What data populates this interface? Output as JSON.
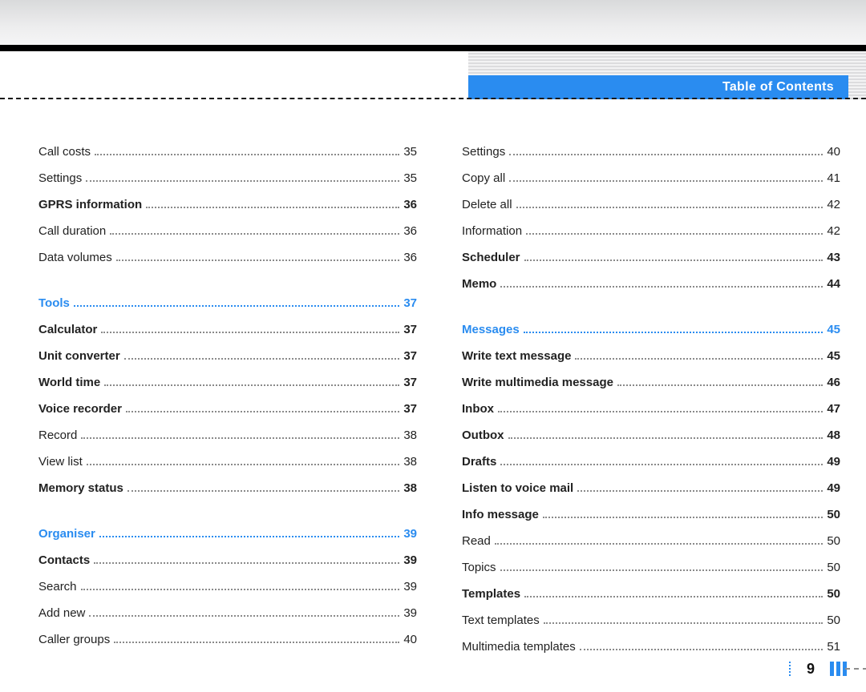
{
  "header": {
    "title": "Table of Contents"
  },
  "page_number": "9",
  "left": [
    {
      "label": "Call costs",
      "page": "35",
      "style": "plain"
    },
    {
      "label": "Settings",
      "page": "35",
      "style": "plain"
    },
    {
      "label": "GPRS information",
      "page": "36",
      "style": "bold"
    },
    {
      "label": "Call duration",
      "page": "36",
      "style": "plain"
    },
    {
      "label": "Data volumes",
      "page": "36",
      "style": "plain"
    },
    {
      "gap": true
    },
    {
      "label": "Tools",
      "page": "37",
      "style": "blue"
    },
    {
      "label": "Calculator",
      "page": "37",
      "style": "bold"
    },
    {
      "label": "Unit converter",
      "page": "37",
      "style": "bold"
    },
    {
      "label": "World time",
      "page": "37",
      "style": "bold"
    },
    {
      "label": "Voice recorder",
      "page": "37",
      "style": "bold"
    },
    {
      "label": "Record",
      "page": "38",
      "style": "plain"
    },
    {
      "label": "View list",
      "page": "38",
      "style": "plain"
    },
    {
      "label": "Memory status",
      "page": "38",
      "style": "bold"
    },
    {
      "gap": true
    },
    {
      "label": "Organiser",
      "page": "39",
      "style": "blue"
    },
    {
      "label": "Contacts",
      "page": "39",
      "style": "bold"
    },
    {
      "label": "Search",
      "page": "39",
      "style": "plain"
    },
    {
      "label": "Add new",
      "page": "39",
      "style": "plain"
    },
    {
      "label": "Caller groups",
      "page": "40",
      "style": "plain"
    }
  ],
  "right": [
    {
      "label": "Settings",
      "page": "40",
      "style": "plain"
    },
    {
      "label": "Copy all",
      "page": "41",
      "style": "plain"
    },
    {
      "label": "Delete all",
      "page": "42",
      "style": "plain"
    },
    {
      "label": "Information",
      "page": "42",
      "style": "plain"
    },
    {
      "label": "Scheduler",
      "page": "43",
      "style": "bold"
    },
    {
      "label": "Memo",
      "page": "44",
      "style": "bold"
    },
    {
      "gap": true
    },
    {
      "label": "Messages",
      "page": "45",
      "style": "blue"
    },
    {
      "label": "Write text message",
      "page": "45",
      "style": "bold"
    },
    {
      "label": "Write multimedia message",
      "page": "46",
      "style": "bold"
    },
    {
      "label": "Inbox",
      "page": "47",
      "style": "bold"
    },
    {
      "label": "Outbox",
      "page": "48",
      "style": "bold"
    },
    {
      "label": "Drafts",
      "page": "49",
      "style": "bold"
    },
    {
      "label": "Listen to voice mail",
      "page": "49",
      "style": "bold"
    },
    {
      "label": "Info message",
      "page": "50",
      "style": "bold"
    },
    {
      "label": "Read",
      "page": "50",
      "style": "plain"
    },
    {
      "label": "Topics",
      "page": "50",
      "style": "plain"
    },
    {
      "label": "Templates",
      "page": "50",
      "style": "bold"
    },
    {
      "label": "Text templates",
      "page": "50",
      "style": "plain"
    },
    {
      "label": "Multimedia templates",
      "page": "51",
      "style": "plain"
    }
  ]
}
